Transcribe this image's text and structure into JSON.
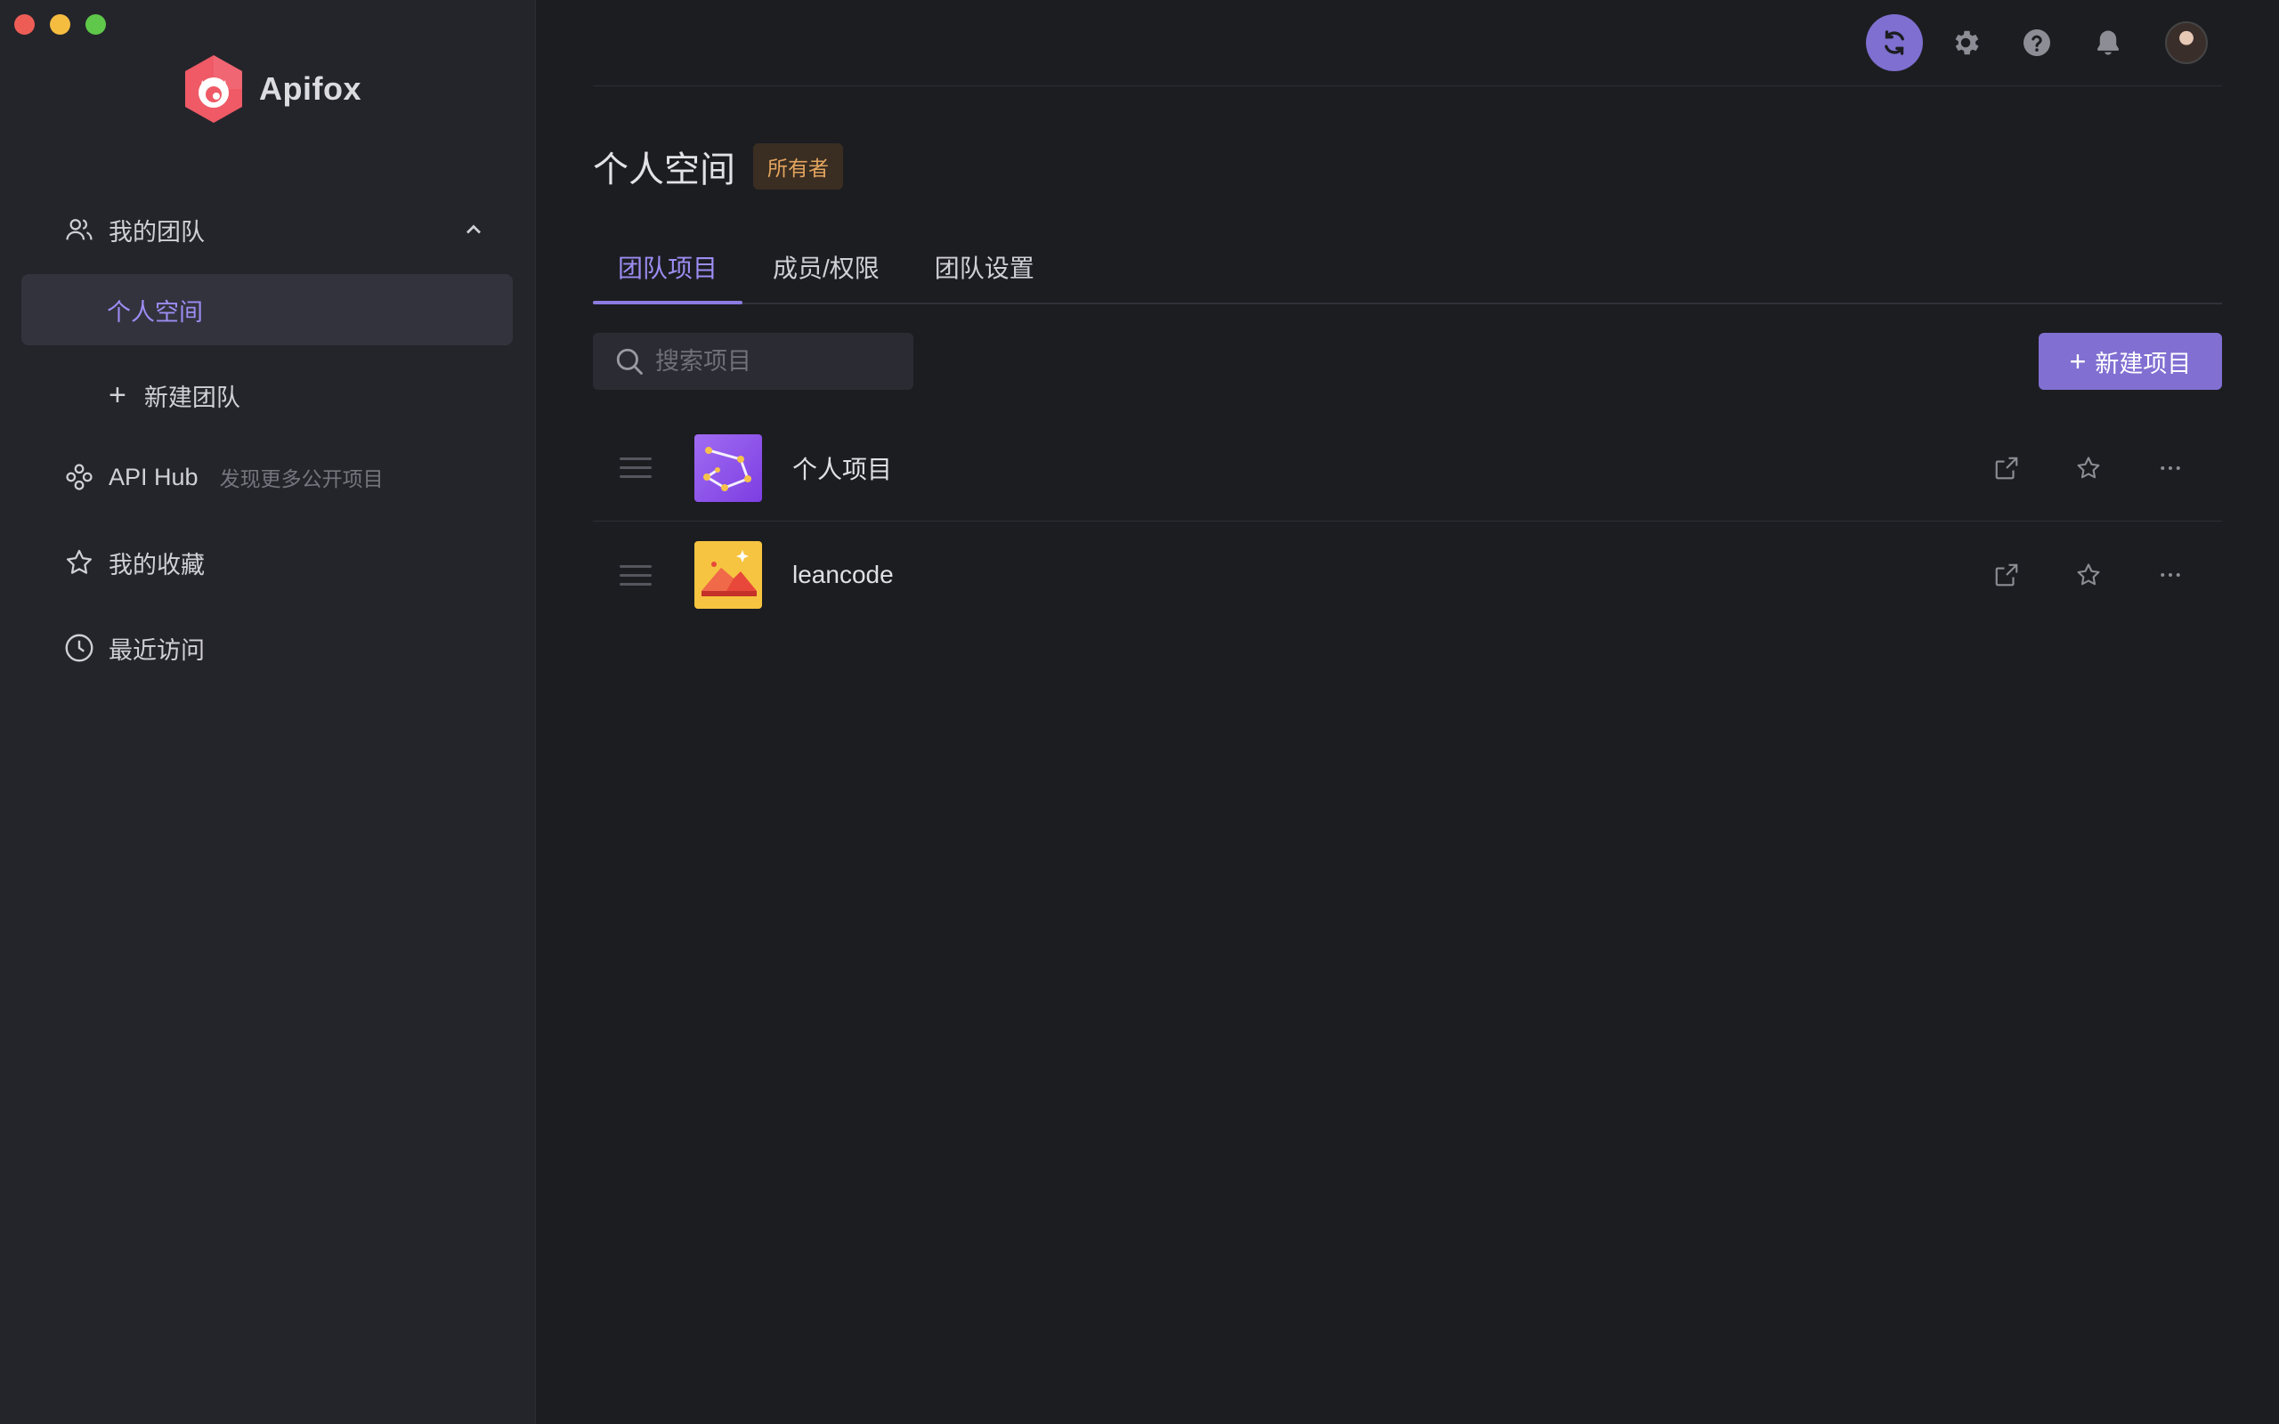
{
  "app": {
    "name": "Apifox"
  },
  "colors": {
    "accent": "#8170d2",
    "accent_text": "#9d8cf2",
    "owner_badge": "#e3a55e"
  },
  "sidebar": {
    "team": {
      "label": "我的团队",
      "icon": "users-icon"
    },
    "personal_space": {
      "label": "个人空间"
    },
    "new_team": {
      "label": "新建团队"
    },
    "api_hub": {
      "label": "API Hub",
      "description": "发现更多公开项目",
      "icon": "hub-icon"
    },
    "favorites": {
      "label": "我的收藏",
      "icon": "star-icon"
    },
    "recent": {
      "label": "最近访问",
      "icon": "clock-icon"
    }
  },
  "header": {
    "icons": [
      "sync-icon",
      "gear-icon",
      "help-icon",
      "bell-icon",
      "avatar"
    ]
  },
  "main": {
    "title": "个人空间",
    "badge": "所有者",
    "tabs": [
      {
        "label": "团队项目",
        "active": true
      },
      {
        "label": "成员/权限",
        "active": false
      },
      {
        "label": "团队设置",
        "active": false
      }
    ],
    "search": {
      "placeholder": "搜索项目",
      "value": ""
    },
    "new_project": {
      "label": "新建项目"
    },
    "projects": [
      {
        "name": "个人项目",
        "icon": "constellation-icon"
      },
      {
        "name": "leancode",
        "icon": "mountain-icon"
      }
    ]
  }
}
